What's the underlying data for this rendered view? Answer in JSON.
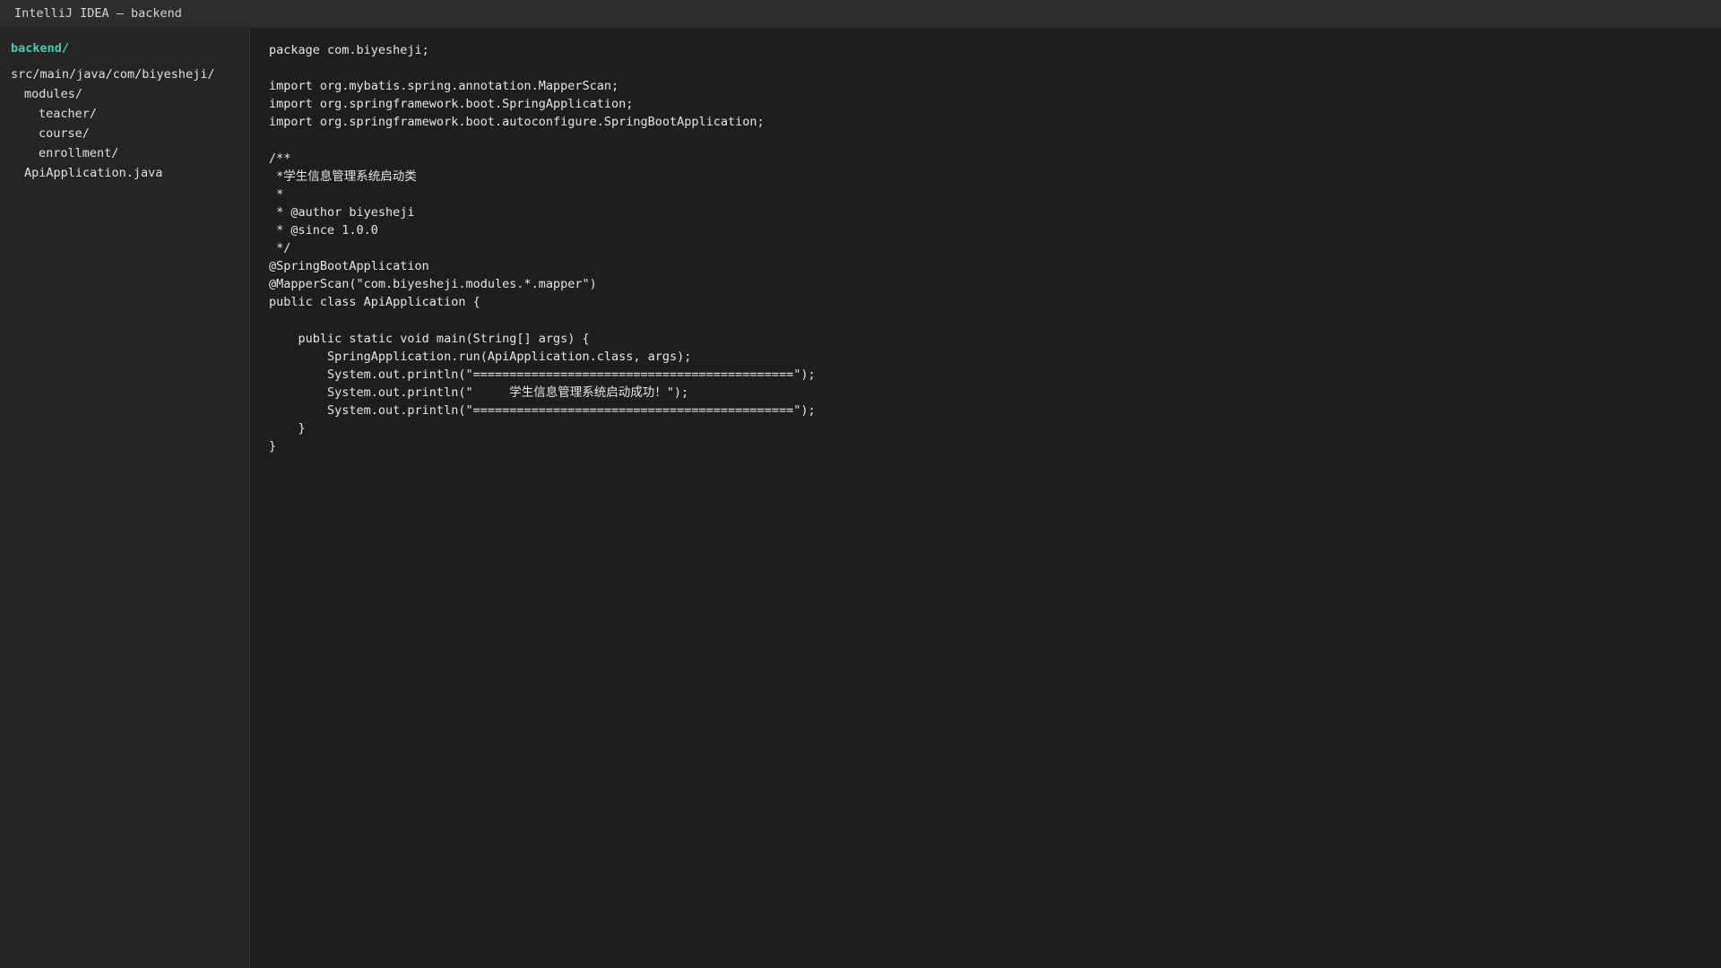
{
  "window": {
    "title": "IntelliJ IDEA — backend"
  },
  "sidebar": {
    "root": "backend/",
    "items": [
      {
        "label": "src/main/java/com/biyesheji/",
        "name": "tree-item-src-path"
      },
      {
        "label": "modules/",
        "name": "tree-item-modules"
      },
      {
        "label": "teacher/",
        "name": "tree-item-teacher"
      },
      {
        "label": "course/",
        "name": "tree-item-course"
      },
      {
        "label": "enrollment/",
        "name": "tree-item-enrollment"
      },
      {
        "label": "ApiApplication.java",
        "name": "tree-item-api-application"
      }
    ]
  },
  "editor": {
    "lines": [
      "package com.biyesheji;",
      "",
      "import org.mybatis.spring.annotation.MapperScan;",
      "import org.springframework.boot.SpringApplication;",
      "import org.springframework.boot.autoconfigure.SpringBootApplication;",
      "",
      "/**",
      " *学生信息管理系统启动类",
      " *",
      " * @author biyesheji",
      " * @since 1.0.0",
      " */",
      "@SpringBootApplication",
      "@MapperScan(\"com.biyesheji.modules.*.mapper\")",
      "public class ApiApplication {",
      "",
      "    public static void main(String[] args) {",
      "        SpringApplication.run(ApiApplication.class, args);",
      "        System.out.println(\"============================================\");",
      "        System.out.println(\"     学生信息管理系统启动成功！\");",
      "        System.out.println(\"============================================\");",
      "    }",
      "}"
    ]
  }
}
